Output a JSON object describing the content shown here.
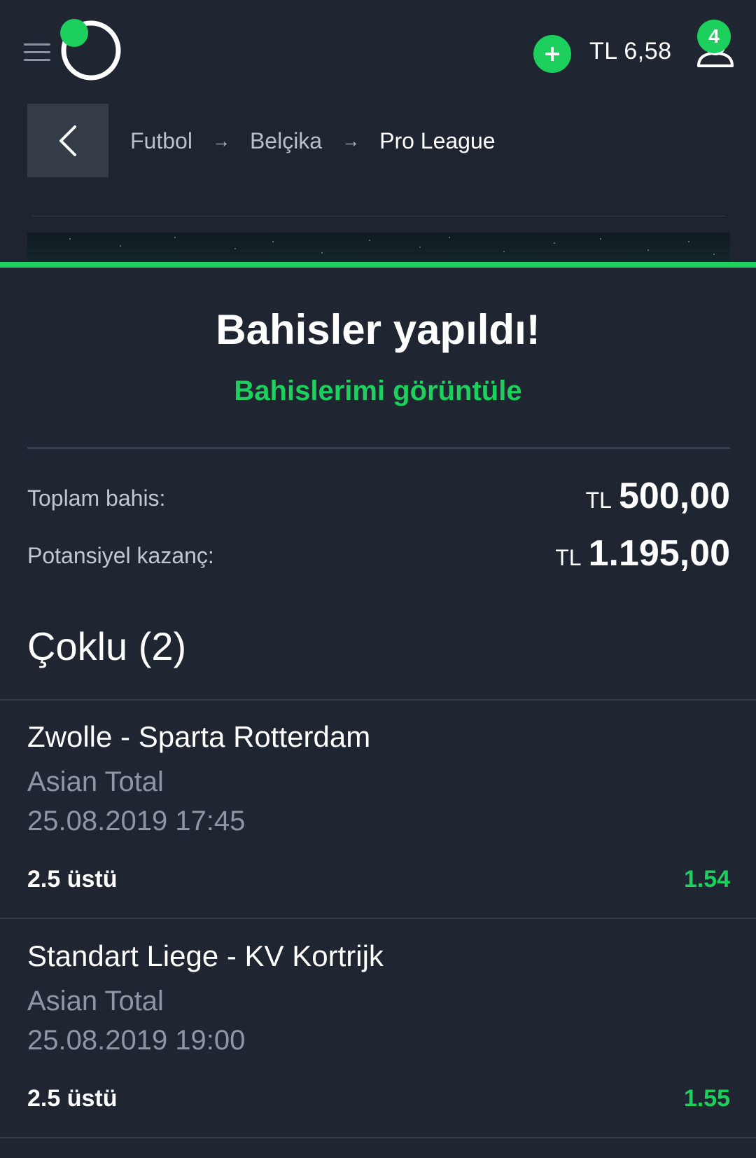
{
  "header": {
    "balance": "TL 6,58",
    "notifications_count": "4",
    "accent_color": "#1dd05d",
    "icons": [
      "hamburger-menu-icon",
      "logo-icon",
      "plus-icon",
      "user-icon"
    ]
  },
  "breadcrumb": {
    "items": [
      "Futbol",
      "Belçika",
      "Pro League"
    ],
    "separator": "→"
  },
  "confirmation": {
    "title": "Bahisler yapıldı!",
    "view_bets_link": "Bahislerimi görüntüle",
    "total_stake_label": "Toplam bahis:",
    "total_stake_currency": "TL",
    "total_stake_amount": "500,00",
    "potential_win_label": "Potansiyel kazanç:",
    "potential_win_currency": "TL",
    "potential_win_amount": "1.195,00",
    "bet_type": "Çoklu (2)"
  },
  "bets": [
    {
      "match": "Zwolle - Sparta Rotterdam",
      "market": "Asian Total",
      "datetime": "25.08.2019 17:45",
      "selection": "2.5 üstü",
      "odds": "1.54"
    },
    {
      "match": "Standart Liege - KV Kortrijk",
      "market": "Asian Total",
      "datetime": "25.08.2019 19:00",
      "selection": "2.5 üstü",
      "odds": "1.55"
    }
  ]
}
